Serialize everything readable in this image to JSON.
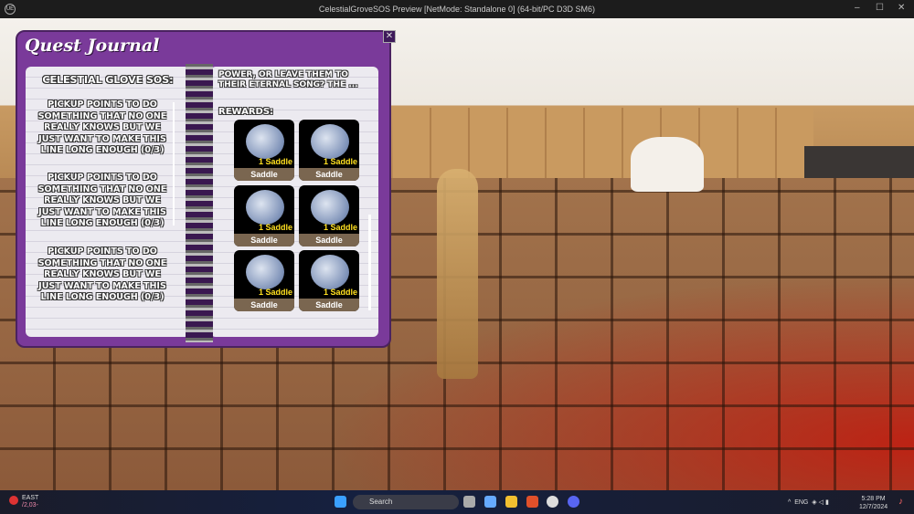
{
  "window": {
    "title": "CelestialGroveSOS Preview [NetMode: Standalone 0]  (64-bit/PC D3D SM6)",
    "minimize": "–",
    "maximize": "☐",
    "close": "✕",
    "logo": "UE"
  },
  "journal": {
    "title": "Quest Journal",
    "close": "✕",
    "quest_title": "Celestial Glove SOS:",
    "objectives": [
      "Pickup points to do something that no one really knows but we just want to make this line long enough (0/3)",
      "Pickup points to do something that no one really knows but we just want to make this line long enough (0/3)",
      "Pickup points to do something that no one really knows but we just want to make this line long enough (0/3)"
    ],
    "story_text": "power, or leave them to their eternal song? The ...",
    "rewards_label": "Rewards:",
    "rewards": [
      {
        "qty": "1 Saddle",
        "name": "Saddle"
      },
      {
        "qty": "1 Saddle",
        "name": "Saddle"
      },
      {
        "qty": "1 Saddle",
        "name": "Saddle"
      },
      {
        "qty": "1 Saddle",
        "name": "Saddle"
      },
      {
        "qty": "1 Saddle",
        "name": "Saddle"
      },
      {
        "qty": "1 Saddle",
        "name": "Saddle"
      }
    ]
  },
  "taskbar": {
    "weather_label": "EAST",
    "weather_sub": "/2,03-",
    "search": "Search",
    "tray_lang": "ENG",
    "time": "5:28 PM",
    "date": "12/7/2024",
    "tray_chevron": "^"
  }
}
